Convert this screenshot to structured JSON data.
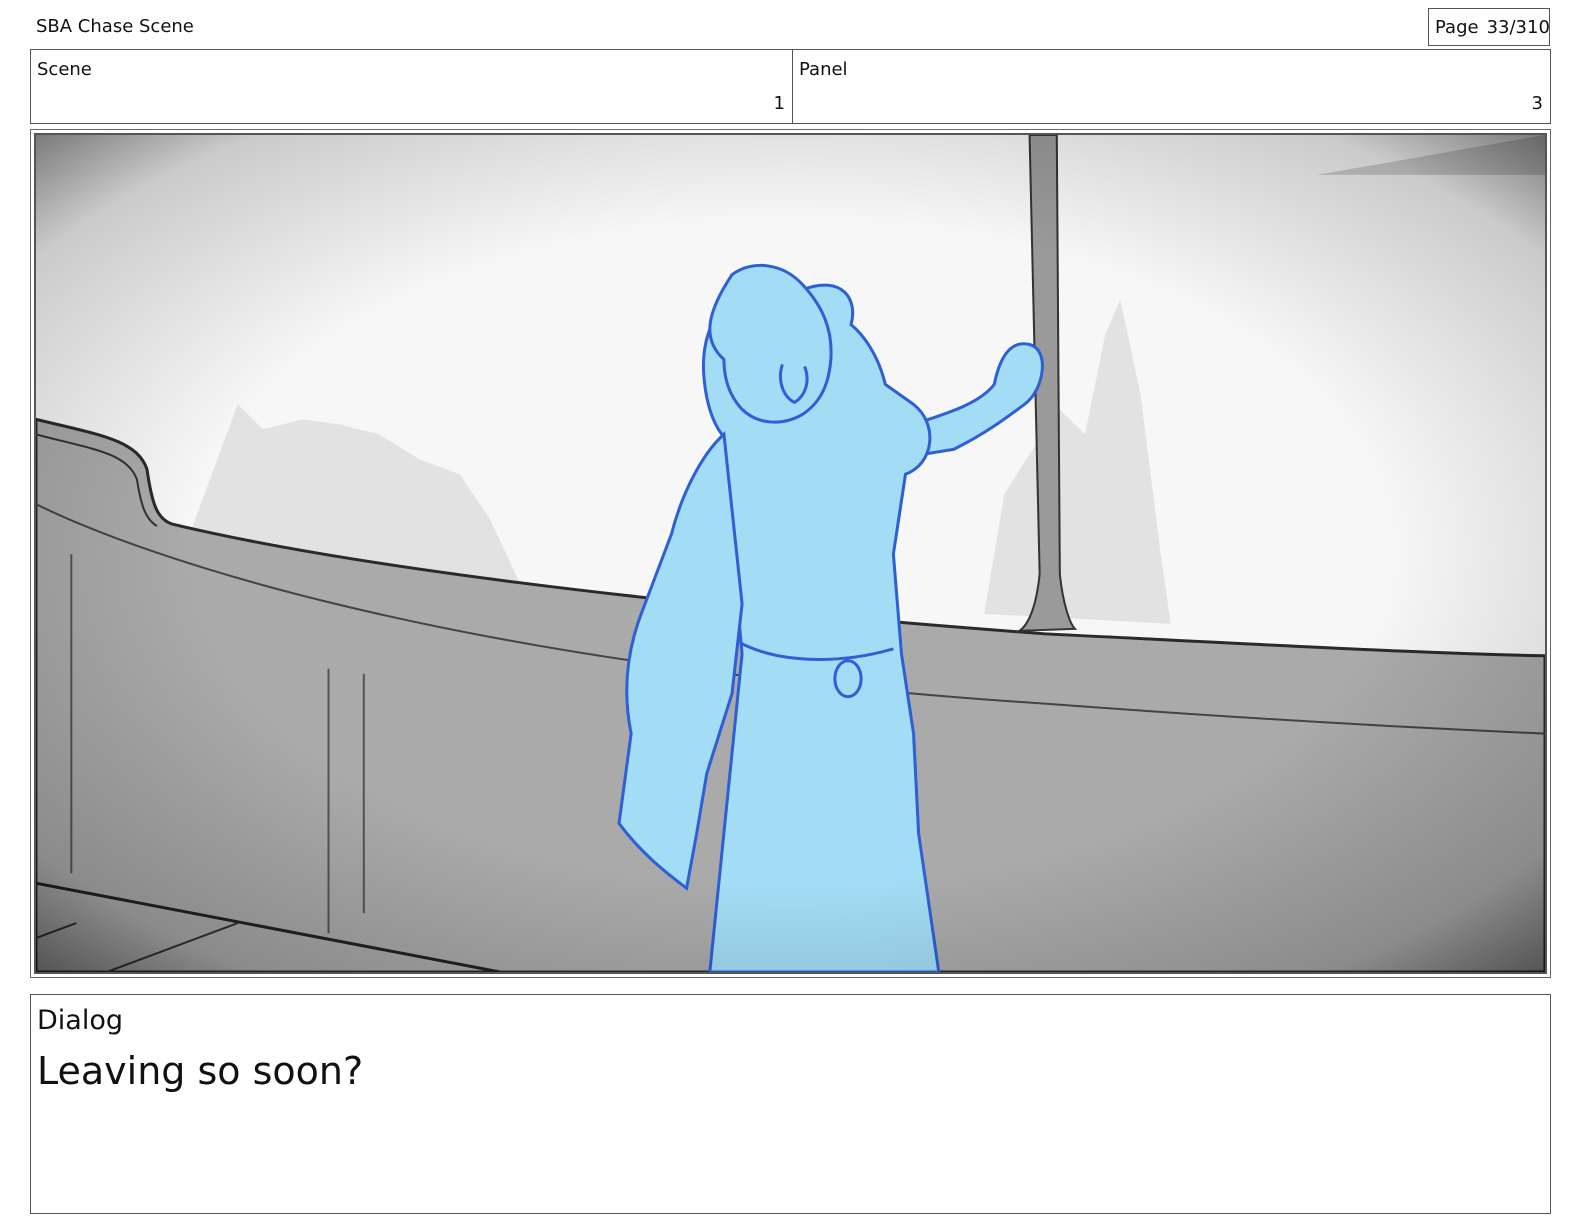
{
  "header": {
    "project_title": "SBA Chase Scene",
    "page_label": "Page",
    "page_value": "33/310"
  },
  "info": {
    "scene_label": "Scene",
    "scene_value": "1",
    "panel_label": "Panel",
    "panel_value": "3"
  },
  "dialog": {
    "label": "Dialog",
    "text": "Leaving so soon?"
  },
  "colors": {
    "figure_fill": "#a3dcf5",
    "figure_line": "#2f5fd6",
    "wall_fill": "#aaaaaa",
    "mountain_fill": "#e2e2e2"
  }
}
